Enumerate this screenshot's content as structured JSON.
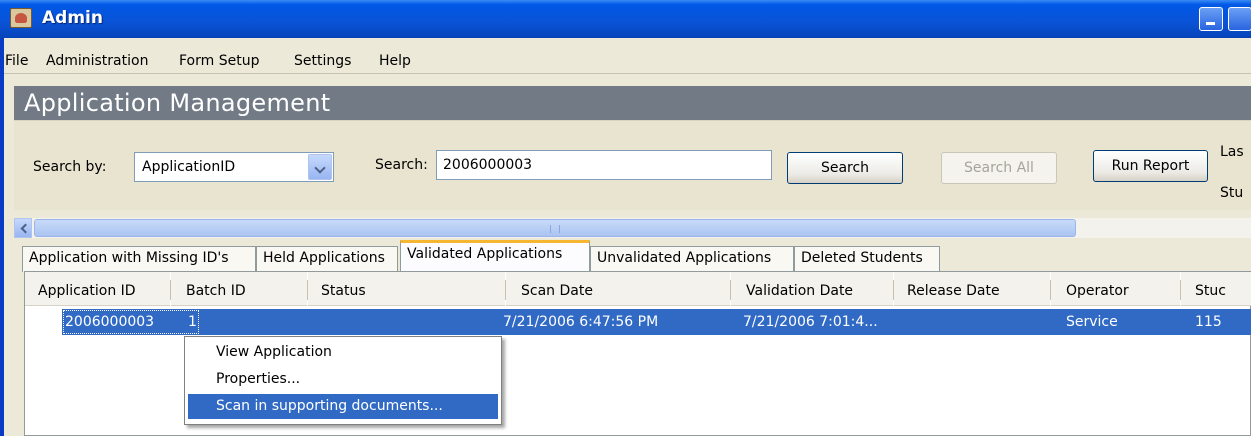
{
  "window": {
    "title": "Admin"
  },
  "menu": [
    "File",
    "Administration",
    "Form Setup",
    "Settings",
    "Help"
  ],
  "header": {
    "title": "Application Management"
  },
  "search": {
    "by_label": "Search by:",
    "by_value": "ApplicationID",
    "search_label": "Search:",
    "search_value": "2006000003",
    "search_button": "Search",
    "search_all_button": "Search All",
    "run_report_button": "Run Report",
    "cut_label_1": "Las",
    "cut_label_2": "Stu"
  },
  "tabs": [
    {
      "label": "Application with Missing ID's",
      "active": false
    },
    {
      "label": "Held Applications",
      "active": false
    },
    {
      "label": "Validated Applications",
      "active": true
    },
    {
      "label": "Unvalidated Applications",
      "active": false
    },
    {
      "label": "Deleted Students",
      "active": false
    }
  ],
  "table": {
    "columns": [
      "Application ID",
      "Batch ID",
      "Status",
      "Scan Date",
      "Validation Date",
      "Release Date",
      "Operator",
      "Stuc"
    ],
    "rows": [
      [
        "2006000003",
        "1",
        "",
        "7/21/2006 6:47:56 PM",
        "7/21/2006 7:01:4...",
        "",
        "Service",
        "115"
      ]
    ]
  },
  "context_menu": {
    "items": [
      "View Application",
      "Properties...",
      "Scan in supporting documents..."
    ],
    "highlighted_index": 2
  },
  "colors": {
    "title_bar": "#0a53d6",
    "selection": "#316ac5",
    "header_band": "#717a85",
    "active_tab_accent": "#f7b632"
  }
}
